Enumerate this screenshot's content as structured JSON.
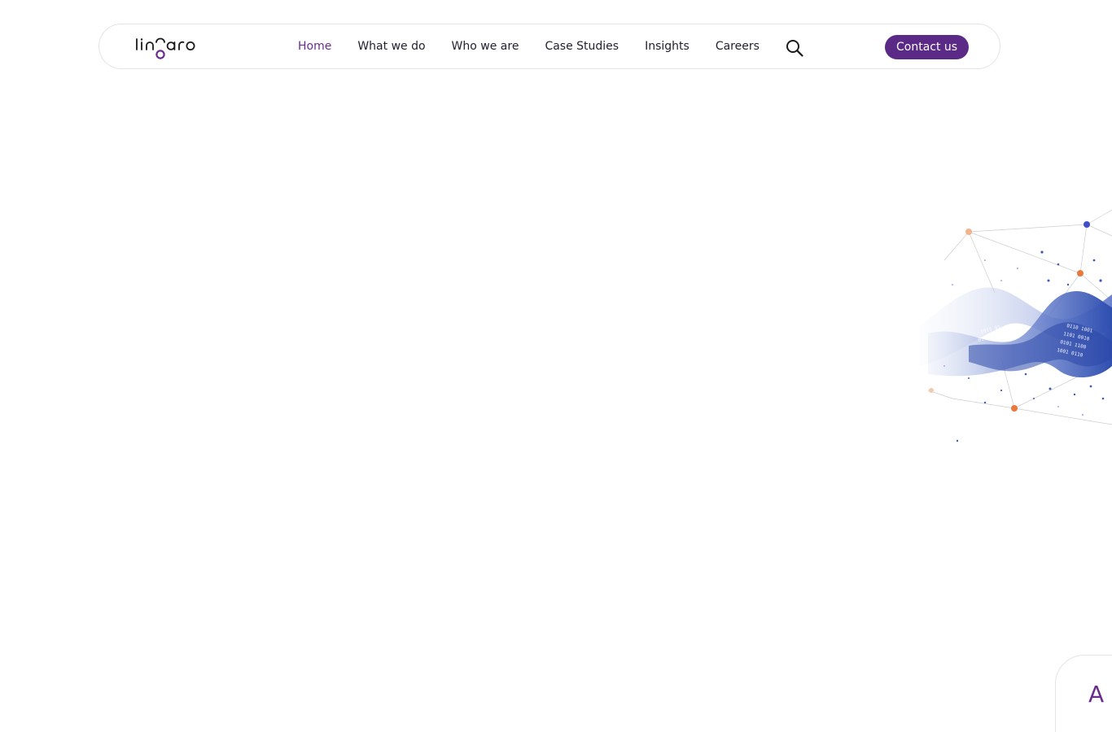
{
  "header": {
    "logo_text": "linaro",
    "nav": [
      {
        "label": "Home",
        "active": true
      },
      {
        "label": "What we do",
        "active": false
      },
      {
        "label": "Who we are",
        "active": false
      },
      {
        "label": "Case Studies",
        "active": false
      },
      {
        "label": "Insights",
        "active": false
      },
      {
        "label": "Careers",
        "active": false
      }
    ],
    "search_icon": "search-icon",
    "contact_label": "Contact us"
  },
  "hero": {
    "visual": "data-network-ribbon-illustration"
  },
  "corner_card": {
    "text_fragment": "A"
  },
  "colors": {
    "brand_purple": "#5b2a86",
    "active_link": "#6a2c8f",
    "text": "#222230",
    "border": "#e4e4e8",
    "ribbon_blue": "#3f5bb8",
    "node_orange": "#e8783c",
    "node_peach": "#f2b48c"
  }
}
